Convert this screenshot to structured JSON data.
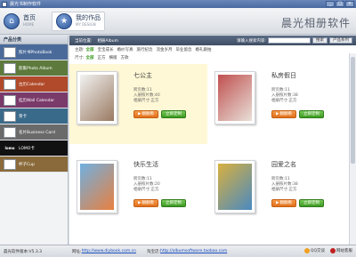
{
  "window": {
    "title": "晨光书制作软件",
    "buttons": [
      "_",
      "□",
      "×"
    ]
  },
  "nav": {
    "home_label": "首页",
    "home_sub": "HOME",
    "works_label": "我的作品",
    "works_sub": "MY DESIGN",
    "brand": "晨光相册软件"
  },
  "sidebar": {
    "header": "产品分类",
    "items": [
      {
        "label": "照片书PhotoBook",
        "color": "#4a6b9a"
      },
      {
        "label": "影集Photo Album",
        "color": "#5d7a3c"
      },
      {
        "label": "台历Calendar",
        "color": "#b04a2a"
      },
      {
        "label": "挂历Wall Calendar",
        "color": "#7a3a6a"
      },
      {
        "label": "贺卡",
        "color": "#3a6a8a"
      },
      {
        "label": "名片Business Card",
        "color": "#6a6a6a"
      },
      {
        "label": "LOMO卡",
        "color": "#111111",
        "icon_text": "lomo"
      },
      {
        "label": "杯子Cup",
        "color": "#8a6a3a"
      }
    ]
  },
  "breadcrumb": {
    "position": "当前位置:",
    "current": "相册Album"
  },
  "search": {
    "label": "请输入搜索内容:",
    "button": "搜索",
    "sort": "产品系列"
  },
  "filters": {
    "theme_label": "主题:",
    "theme_options": [
      "全部",
      "宝宝成长",
      "婚纱写真",
      "旅行纪念",
      "流金岁月",
      "毕业留念",
      "婚礼跟拍"
    ],
    "size_label": "尺寸:",
    "size_options": [
      "全部",
      "正方",
      "横版",
      "方款"
    ]
  },
  "cards": [
    {
      "title": "七公主",
      "pages": "跨页数:11",
      "photos": "入册照片数:40",
      "size": "相册尺寸:正方",
      "btn1": "翻翻看",
      "btn2": "立即定制",
      "highlight": true,
      "colors": [
        "#f2f2f2",
        "#9a7a62"
      ]
    },
    {
      "title": "私房假日",
      "pages": "跨页数:11",
      "photos": "入册照片数:38",
      "size": "相册尺寸:正方",
      "btn1": "翻翻看",
      "btn2": "立即定制",
      "highlight": false,
      "colors": [
        "#c05050",
        "#e8e0d8"
      ]
    },
    {
      "title": "快乐生活",
      "pages": "跨页数:11",
      "photos": "入册照片数:20",
      "size": "相册尺寸:正方",
      "btn1": "翻翻看",
      "btn2": "立即定制",
      "highlight": false,
      "colors": [
        "#70b0e0",
        "#e88040"
      ]
    },
    {
      "title": "园爱之名",
      "pages": "跨页数:11",
      "photos": "入册照片数:38",
      "size": "相册尺寸:正方",
      "btn1": "翻翻看",
      "btn2": "立即定制",
      "highlight": false,
      "colors": [
        "#d8b040",
        "#4a8ac0"
      ]
    }
  ],
  "status": {
    "version": "晨光软件版本:V5.3.3",
    "site_label": "网址:",
    "site_url": "http://www.diybook.com.cn",
    "shop_label": "淘宝店:",
    "shop_url": "http://albumsoftware.taobao.com",
    "qq1": "QQ交谈",
    "qq2": "网站客服"
  }
}
